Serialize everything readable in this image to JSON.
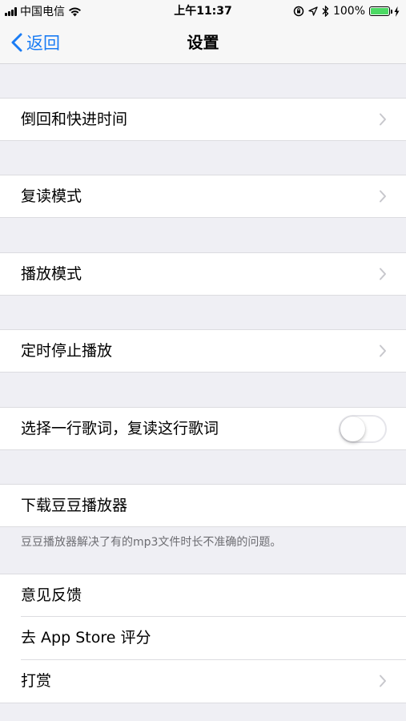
{
  "status_bar": {
    "carrier": "中国电信",
    "time": "上午11:37",
    "battery_percent": "100%",
    "battery_color": "#4cd964"
  },
  "nav": {
    "back_label": "返回",
    "title": "设置",
    "accent_color": "#1a7cf4"
  },
  "settings": {
    "rewind_forward_time": "倒回和快进时间",
    "repeat_mode": "复读模式",
    "play_mode": "播放模式",
    "sleep_timer": "定时停止播放",
    "select_lyric_repeat": "选择一行歌词，复读这行歌词",
    "select_lyric_repeat_enabled": false,
    "download_player": "下载豆豆播放器",
    "download_player_note": "豆豆播放器解决了有的mp3文件时长不准确的问题。",
    "feedback": "意见反馈",
    "rate_app_store": "去 App Store 评分",
    "tip": "打赏"
  },
  "icons": {
    "back": "chevron-left-icon",
    "disclosure": "chevron-right-icon",
    "wifi": "wifi-icon",
    "signal": "signal-icon",
    "lock_rotation": "lock-rotation-icon",
    "location": "location-arrow-icon",
    "bluetooth": "bluetooth-icon",
    "charging": "charging-bolt-icon"
  }
}
